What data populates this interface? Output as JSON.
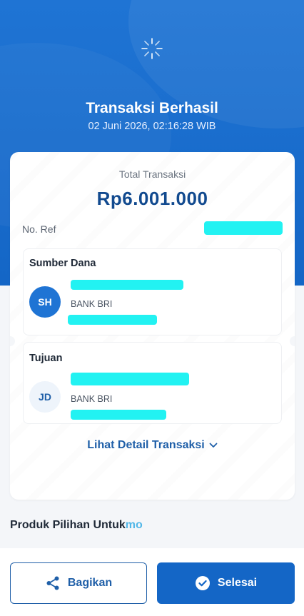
{
  "header": {
    "title": "Transaksi Berhasil",
    "datetime": "02 Juni 2026, 02:16:28 WIB",
    "icon": "loading-spinner-icon"
  },
  "summary": {
    "total_label": "Total Transaksi",
    "total_amount": "Rp6.001.000",
    "noref_label": "No. Ref"
  },
  "source": {
    "title": "Sumber Dana",
    "initials": "SH",
    "bank": "BANK BRI"
  },
  "destination": {
    "title": "Tujuan",
    "initials": "JD",
    "bank": "BANK BRI"
  },
  "detail_link": {
    "label": "Lihat Detail Transaksi",
    "icon": "chevron-down-icon"
  },
  "promo": {
    "label": "Produk Pilihan Untuk",
    "suffix": "mo"
  },
  "footer": {
    "share_label": "Bagikan",
    "share_icon": "share-icon",
    "done_label": "Selesai",
    "done_icon": "check-circle-icon"
  },
  "colors": {
    "primary": "#1466c6",
    "amount": "#124a8f",
    "redaction": "#22f2f2"
  }
}
